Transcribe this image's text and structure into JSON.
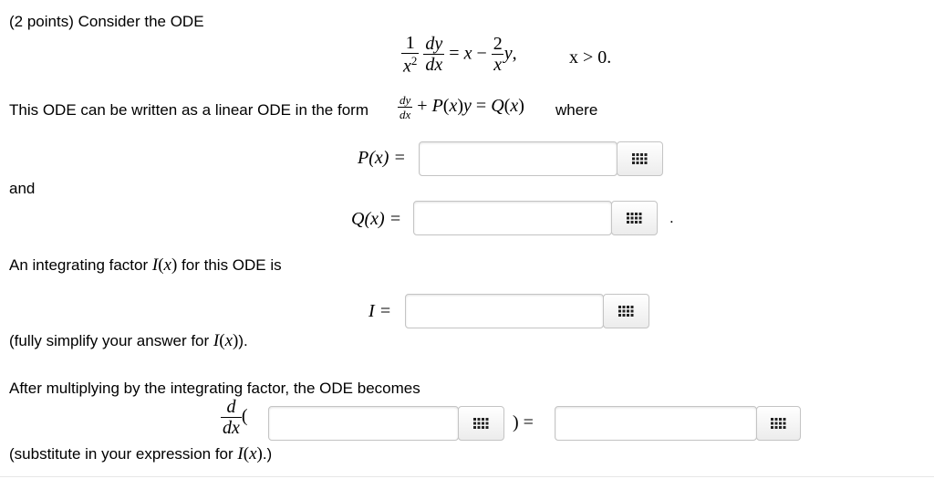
{
  "problem": {
    "intro": "(2 points) Consider the ODE",
    "ode_condition": "x > 0.",
    "linear_form_prefix": "This ODE can be written as a linear ODE in the form",
    "linear_form_suffix": "where",
    "and_label": "and",
    "q_trailing": ".",
    "integrating_factor_text": "An integrating factor",
    "integrating_factor_suffix": "for this ODE is",
    "simplify_prefix": "(fully simplify your answer for",
    "simplify_suffix": ").",
    "after_text": "After multiplying by the integrating factor, the ODE becomes",
    "substitute_prefix": "(substitute in your expression for",
    "substitute_suffix": ".)"
  },
  "answers": {
    "p": {
      "label": "P(x) =",
      "value": "",
      "placeholder": ""
    },
    "q": {
      "label": "Q(x) =",
      "value": "",
      "placeholder": ""
    },
    "i": {
      "label": "I =",
      "value": "",
      "placeholder": ""
    },
    "lhs": {
      "value": "",
      "placeholder": ""
    },
    "rhs": {
      "value": "",
      "placeholder": ""
    }
  },
  "icons": {
    "equation_editor": "grid-icon"
  },
  "colors": {
    "field_border": "#c4c4c4",
    "button_bg": "#ececec",
    "text": "#000000"
  }
}
